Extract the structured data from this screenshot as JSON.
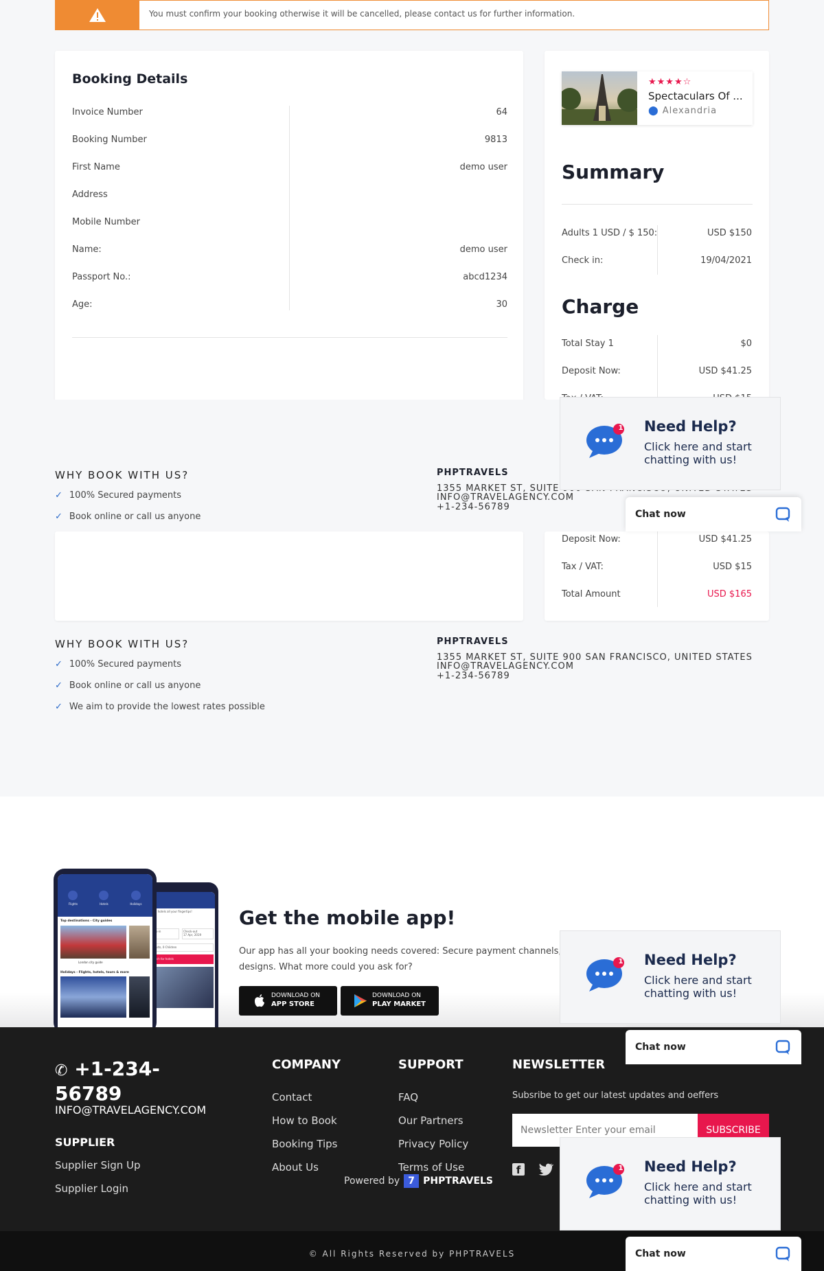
{
  "alert": {
    "text": "You must confirm your booking otherwise it will be cancelled, please contact us for further information."
  },
  "booking": {
    "title": "Booking Details",
    "rows": [
      {
        "label": "Invoice Number",
        "value": "64"
      },
      {
        "label": "Booking Number",
        "value": "9813"
      },
      {
        "label": "First Name",
        "value": "demo user"
      },
      {
        "label": "Address",
        "value": ""
      },
      {
        "label": "Mobile Number",
        "value": ""
      },
      {
        "label": "Name:",
        "value": "demo user"
      },
      {
        "label": "Passport No.:",
        "value": "abcd1234"
      },
      {
        "label": "Age:",
        "value": "30"
      }
    ]
  },
  "tour": {
    "name": "Spectaculars Of ...",
    "location": "Alexandria",
    "stars": 4,
    "star_color": "#e8174d"
  },
  "summary": {
    "title": "Summary",
    "rows": [
      {
        "label": "Adults 1 USD / $ 150:",
        "value": "USD $150"
      },
      {
        "label": "Check in:",
        "value": "19/04/2021"
      }
    ]
  },
  "charge": {
    "title": "Charge",
    "rows": [
      {
        "label": "Total Stay 1",
        "value": "$0"
      },
      {
        "label": "Deposit Now:",
        "value": "USD $41.25"
      },
      {
        "label": "Tax / VAT:",
        "value": "USD $15"
      },
      {
        "label": "Total Amount",
        "value": "USD $165"
      }
    ],
    "total_color": "#e8174d"
  },
  "why": {
    "title": "WHY BOOK WITH US?",
    "items": [
      "100% Secured payments",
      "Book online or call us anyone",
      "We aim to provide the lowest rates possible"
    ]
  },
  "company": {
    "name": "PHPTRAVELS",
    "address": "1355 MARKET ST, SUITE 900 SAN FRANCISCO, UNITED STATES",
    "email": "INFO@TRAVELAGENCY.COM",
    "phone": "+1-234-56789"
  },
  "app": {
    "title": "Get the mobile app!",
    "desc": "Our app has all your booking needs covered: Secure payment channels, e",
    "desc2": "designs. What more could you ask for?",
    "appstore_top": "DOWNLOAD ON",
    "appstore_bottom": "APP STORE",
    "play_top": "DOWNLOAD ON",
    "play_bottom": "PLAY MARKET",
    "phone_screen": {
      "tabs": [
        "Flights",
        "Hotels",
        "Holidays"
      ],
      "section1": "Top destinations - City guides",
      "card1": "London city guide",
      "section2": "Holidays - Flights, hotels, tours & more",
      "form_label": "million hotels all your fingertips!",
      "checkin_label": "Check-in",
      "checkin_date": "2019",
      "checkout_label": "Check-out",
      "checkout_date": "17 Apr, 2019",
      "guests": "2 Adults, 0 Children",
      "search_btn": "Search for hotels"
    }
  },
  "help": {
    "title": "Need Help?",
    "text": "Click here and start chatting with us!",
    "badge": "1",
    "chat_label": "Chat now"
  },
  "footer": {
    "phone": "+1-234-56789",
    "email": "INFO@TRAVELAGENCY.COM",
    "supplier_title": "SUPPLIER",
    "supplier_links": [
      "Supplier Sign Up",
      "Supplier Login"
    ],
    "company_title": "COMPANY",
    "company_links": [
      "Contact",
      "How to Book",
      "Booking Tips",
      "About Us"
    ],
    "support_title": "SUPPORT",
    "support_links": [
      "FAQ",
      "Our Partners",
      "Privacy Policy",
      "Terms of Use"
    ],
    "newsletter_title": "NEWSLETTER",
    "newsletter_text": "Subsribe to get our latest updates and oeffers",
    "newsletter_placeholder": "Newsletter Enter your email",
    "subscribe_label": "SUBSCRIBE",
    "powered_label": "Powered by",
    "powered_brand": "PHPTRAVELS",
    "copyright": "© All Rights Reserved by PHPTRAVELS"
  },
  "colors": {
    "accent_orange": "#ef8b33",
    "accent_pink": "#e8174d",
    "chat_blue": "#2a6dd6"
  }
}
